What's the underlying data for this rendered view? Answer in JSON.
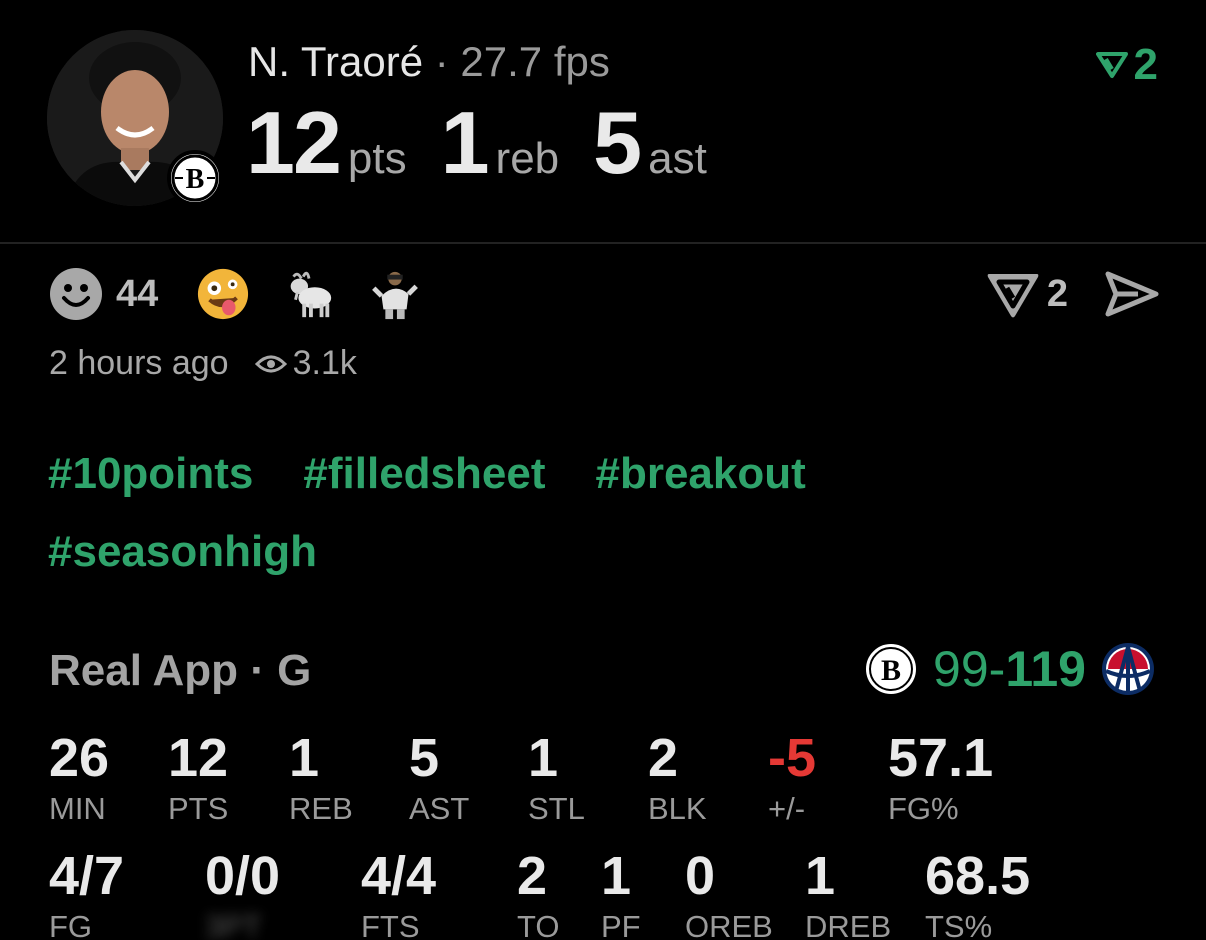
{
  "player": {
    "name": "N. Traoré",
    "sep": "·",
    "fps": "27.7 fps",
    "pts": "12",
    "pts_unit": "pts",
    "reb": "1",
    "reb_unit": "reb",
    "ast": "5",
    "ast_unit": "ast"
  },
  "vote_top": {
    "count": "2",
    "color": "#2fa36b"
  },
  "reactions": {
    "count": "44",
    "emojis": [
      "zany-face-emoji",
      "goat-emoji",
      "player-sticker-emoji"
    ]
  },
  "actions": {
    "vote_count": "2"
  },
  "meta": {
    "time": "2 hours ago",
    "views": "3.1k"
  },
  "hashtags": [
    "#10points",
    "#filledsheet",
    "#breakout",
    "#seasonhigh"
  ],
  "game": {
    "title": "Real App · G",
    "score_home": "99",
    "score_dash": "-",
    "score_away": "119"
  },
  "stats_row1": [
    {
      "value": "26",
      "label": "MIN"
    },
    {
      "value": "12",
      "label": "PTS"
    },
    {
      "value": "1",
      "label": "REB"
    },
    {
      "value": "5",
      "label": "AST"
    },
    {
      "value": "1",
      "label": "STL"
    },
    {
      "value": "2",
      "label": "BLK"
    },
    {
      "value": "-5",
      "label": "+/-"
    },
    {
      "value": "57.1",
      "label": "FG%"
    }
  ],
  "stats_row2": [
    {
      "value": "4/7",
      "label": "FG"
    },
    {
      "value": "0/0",
      "label": "3PT"
    },
    {
      "value": "4/4",
      "label": "FTS"
    },
    {
      "value": "2",
      "label": "TO"
    },
    {
      "value": "1",
      "label": "PF"
    },
    {
      "value": "0",
      "label": "OREB"
    },
    {
      "value": "1",
      "label": "DREB"
    },
    {
      "value": "68.5",
      "label": "TS%"
    }
  ],
  "colors": {
    "accent": "#2fa36b",
    "negative": "#e53935",
    "wizards_red": "#c8102e",
    "wizards_blue": "#0c2c64"
  }
}
